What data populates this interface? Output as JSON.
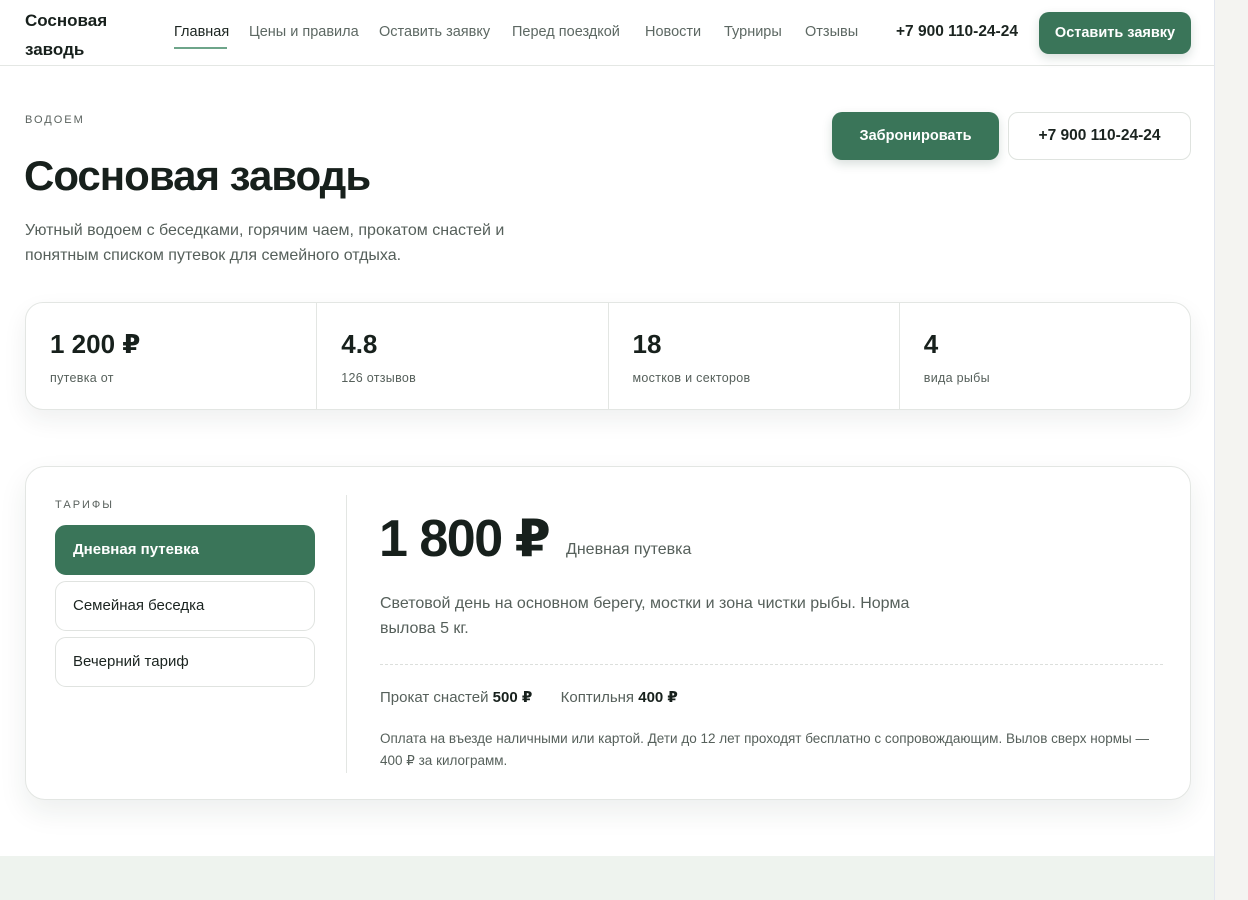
{
  "header": {
    "brand": "Сосновая заводь",
    "nav": [
      "Главная",
      "Цены и правила",
      "Оставить заявку",
      "Перед поездкой",
      "Новости",
      "Турниры",
      "Отзывы"
    ],
    "active_nav": "Главная",
    "phone": "+7 900 110-24-24",
    "cta_label": "Оставить заявку"
  },
  "hero": {
    "eyebrow": "ВОДОЕМ",
    "title": "Сосновая заводь",
    "lead": "Уютный водоем с беседками, горячим чаем, прокатом снастей и понятным списком путевок для семейного отдыха.",
    "book_label": "Забронировать",
    "phone_label": "+7 900 110-24-24"
  },
  "stats": [
    {
      "value": "1 200 ₽",
      "label": "путевка от"
    },
    {
      "value": "4.8",
      "label": "126 отзывов"
    },
    {
      "value": "18",
      "label": "мостков и секторов"
    },
    {
      "value": "4",
      "label": "вида рыбы"
    }
  ],
  "tariffs": {
    "eyebrow": "ТАРИФЫ",
    "tabs": [
      "Дневная путевка",
      "Семейная беседка",
      "Вечерний тариф"
    ],
    "active_tab": "Дневная путевка",
    "price": "1 800 ₽",
    "price_name": "Дневная путевка",
    "description": "Световой день на основном берегу, мостки и зона чистки рыбы. Норма вылова 5 кг.",
    "extras": [
      {
        "label": "Прокат снастей",
        "price": "500 ₽"
      },
      {
        "label": "Коптильня",
        "price": "400 ₽"
      }
    ],
    "note": "Оплата на въезде наличными или картой. Дети до 12 лет проходят бесплатно с сопровождающим. Вылов сверх нормы — 400 ₽ за килограмм."
  },
  "colors": {
    "accent": "#3a7559",
    "nav_underline": "#6ea58a",
    "bottom_band": "#eef3ee"
  }
}
